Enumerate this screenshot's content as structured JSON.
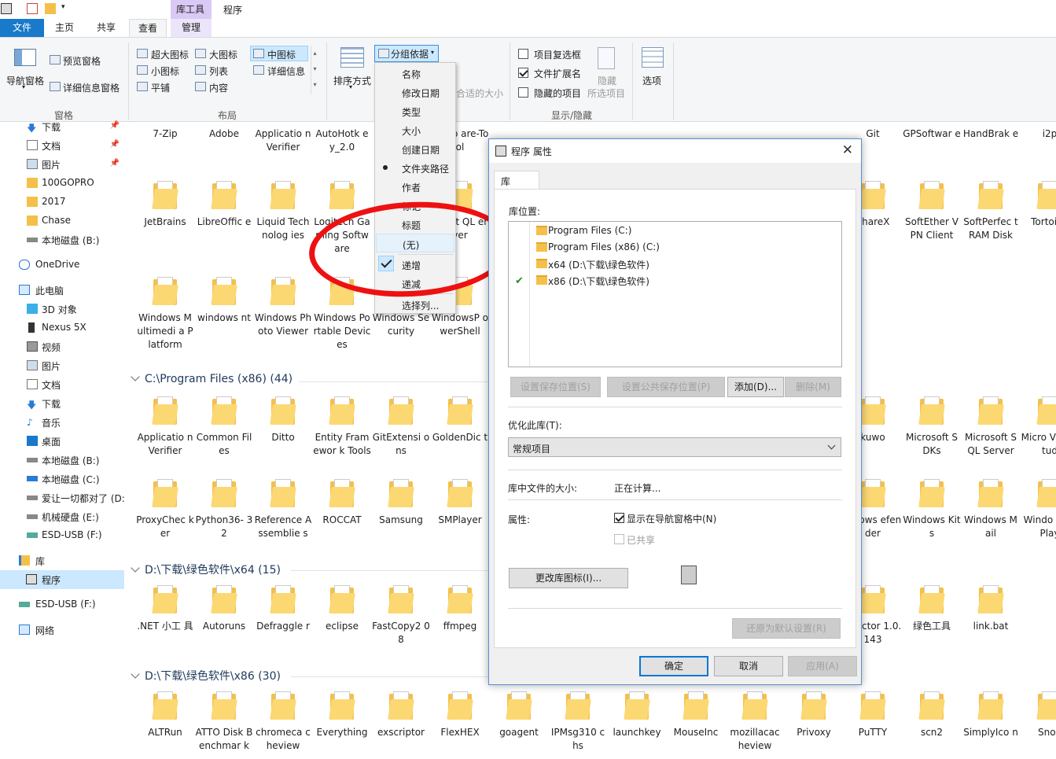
{
  "window": {
    "context_tab_group": "库工具",
    "title": "程序"
  },
  "tabs": [
    "文件",
    "主页",
    "共享",
    "查看",
    "管理"
  ],
  "ribbon": {
    "pane_group": {
      "nav_pane": "导航窗格",
      "preview_pane": "预览窗格",
      "details_pane": "详细信息窗格",
      "label": "窗格"
    },
    "layout_group": {
      "items": [
        "超大图标",
        "大图标",
        "中图标",
        "小图标",
        "列表",
        "详细信息",
        "平铺",
        "内容"
      ],
      "label": "布局"
    },
    "sort": {
      "label": "排序方式",
      "group_by": "分组依据",
      "fit_columns": "合适的大小"
    },
    "show_hide": {
      "item_checkbox": "项目复选框",
      "file_ext": "文件扩展名",
      "hidden_items": "隐藏的项目",
      "hide_selected_1": "隐藏",
      "hide_selected_2": "所选项目",
      "label": "显示/隐藏",
      "options": "选项"
    }
  },
  "nav": [
    {
      "label": "下载",
      "pin": "📌"
    },
    {
      "label": "文档",
      "pin": "📌"
    },
    {
      "label": "图片",
      "pin": "📌"
    },
    {
      "label": "100GOPRO"
    },
    {
      "label": "2017"
    },
    {
      "label": "Chase"
    },
    {
      "label": "本地磁盘 (B:)"
    },
    {
      "label": "OneDrive"
    },
    {
      "label": "此电脑"
    },
    {
      "label": "3D 对象"
    },
    {
      "label": "Nexus 5X"
    },
    {
      "label": "视频"
    },
    {
      "label": "图片"
    },
    {
      "label": "文档"
    },
    {
      "label": "下载"
    },
    {
      "label": "音乐"
    },
    {
      "label": "桌面"
    },
    {
      "label": "本地磁盘 (B:)"
    },
    {
      "label": "本地磁盘 (C:)"
    },
    {
      "label": "爱让一切都对了 (D:"
    },
    {
      "label": "机械硬盘 (E:)"
    },
    {
      "label": "ESD-USB (F:)"
    },
    {
      "label": "库"
    },
    {
      "label": "程序"
    },
    {
      "label": "ESD-USB (F:)"
    },
    {
      "label": "网络"
    }
  ],
  "groups": {
    "g1": "C:\\Program Files (x86) (44)",
    "g2": "D:\\下载\\绿色软件\\x64 (15)",
    "g3": "D:\\下载\\绿色软件\\x86 (30)"
  },
  "files": {
    "row0": [
      "7-Zip",
      "Adobe",
      "Applicatio n Verifier",
      "AutoHotk ey_2.0",
      "se-Co are-To ol",
      "Git",
      "GPSoftwar e",
      "HandBrak e",
      "i2p"
    ],
    "row1": [
      "JetBrains",
      "LibreOffic e",
      "Liquid Technolog ies",
      "Logitech Gaming Software",
      "rosoft QL erver",
      "ShareX",
      "SoftEther VPN Client",
      "SoftPerfec t RAM Disk",
      "Tortois t"
    ],
    "row2": [
      "Windows Multimedi a Platform",
      "windows nt",
      "Windows Photo Viewer",
      "Windows Portable Devices",
      "Windows Security",
      "WindowsP owerShell"
    ],
    "row3": [
      "Applicatio n Verifier",
      "Common Files",
      "Ditto",
      "Entity Framewor k Tools",
      "GitExtensi ons",
      "GoldenDic t",
      "kuwo",
      "Microsoft SDKs",
      "Microsoft SQL Server",
      "Micro Visu Stud"
    ],
    "row4": [
      "ProxyChec ker",
      "Python36- 32",
      "Reference Assemblie s",
      "ROCCAT",
      "Samsung",
      "SMPlayer",
      "indows efender",
      "Windows Kits",
      "Windows Mail",
      "Windo Med Play"
    ],
    "row5": [
      ".NET 小工 具",
      "Autoruns",
      "Defraggle r",
      "eclipse",
      "FastCopy2 08",
      "ffmpeg",
      "eflector 1.0.143",
      "绿色工具",
      "link.bat"
    ],
    "row6": [
      "ALTRun",
      "ATTO Disk Benchmar k",
      "chromeca cheview",
      "Everything",
      "exscriptor",
      "FlexHEX",
      "goagent",
      "IPMsg310 chs",
      "launchkey",
      "MouseInc",
      "mozillacac heview",
      "Privoxy",
      "PuTTY",
      "scn2",
      "SimplyIco n",
      "Snoo"
    ]
  },
  "dropdown": {
    "items": [
      "名称",
      "修改日期",
      "类型",
      "大小",
      "创建日期",
      "文件夹路径",
      "作者",
      "标记",
      "标题",
      "(无)",
      "递增",
      "递减",
      "选择列..."
    ]
  },
  "dialog": {
    "title": "程序 属性",
    "tab": "库",
    "locations_label": "库位置:",
    "locations": [
      "Program Files (C:)",
      "Program Files (x86) (C:)",
      "x64 (D:\\下载\\绿色软件)",
      "x86 (D:\\下载\\绿色软件)"
    ],
    "btn_set_save": "设置保存位置(S)",
    "btn_set_public": "设置公共保存位置(P)",
    "btn_add": "添加(D)...",
    "btn_remove": "删除(M)",
    "optimize_label": "优化此库(T):",
    "optimize_value": "常规项目",
    "size_label": "库中文件的大小:",
    "size_value": "正在计算...",
    "attr_label": "属性:",
    "show_in_nav": "显示在导航窗格中(N)",
    "shared": "已共享",
    "change_icon": "更改库图标(I)...",
    "restore": "还原为默认设置(R)",
    "ok": "确定",
    "cancel": "取消",
    "apply": "应用(A)"
  },
  "colors": {
    "accent": "#1979ca",
    "context_tab": "#d9c9f5",
    "annotation": "#e11111"
  }
}
